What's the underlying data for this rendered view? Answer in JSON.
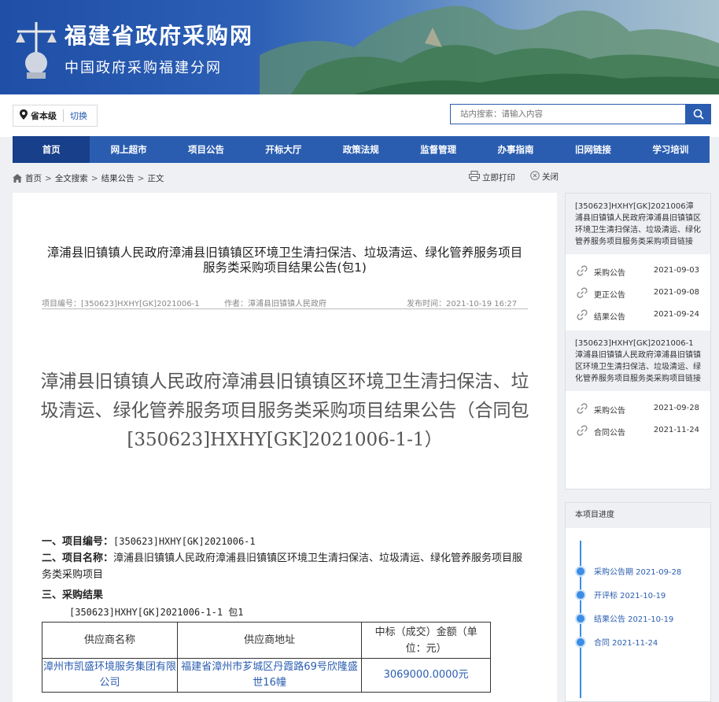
{
  "header": {
    "title": "福建省政府采购网",
    "subtitle": "中国政府采购福建分网"
  },
  "region": {
    "current": "省本级",
    "switch_label": "切换"
  },
  "search": {
    "placeholder": "站内搜索：请输入内容"
  },
  "nav": [
    "首页",
    "网上超市",
    "项目公告",
    "开标大厅",
    "政策法规",
    "监督管理",
    "办事指南",
    "旧网链接",
    "学习培训"
  ],
  "breadcrumb": [
    "首页",
    "全文搜索",
    "结果公告",
    "正文"
  ],
  "tools": {
    "print": "立即打印",
    "close": "关闭"
  },
  "article": {
    "title": "漳浦县旧镇镇人民政府漳浦县旧镇镇区环境卫生清扫保洁、垃圾清运、绿化管养服务项目服务类采购项目结果公告(包1)",
    "meta": {
      "project_no": "项目编号：[350623]HXHY[GK]2021006-1",
      "author": "作者：漳浦县旧镇镇人民政府",
      "published": "发布时间：2021-10-19 16:27"
    },
    "doc_heading": "漳浦县旧镇镇人民政府漳浦县旧镇镇区环境卫生清扫保洁、垃圾清运、绿化管养服务项目服务类采购项目结果公告（合同包[350623]HXHY[GK]2021006-1-1）",
    "sec1_label": "一、项目编号：",
    "sec1_value": "[350623]HXHY[GK]2021006-1",
    "sec2_label": "二、项目名称：",
    "sec2_value": "漳浦县旧镇镇人民政府漳浦县旧镇镇区环境卫生清扫保洁、垃圾清运、绿化管养服务项目服务类采购项目",
    "sec3_label": "三、采购结果",
    "package_line": "[350623]HXHY[GK]2021006-1-1 包1",
    "table": {
      "headers": [
        "供应商名称",
        "供应商地址",
        "中标（成交）金额（单位：元）"
      ],
      "rows": [
        [
          "漳州市凯盛环境服务集团有限公司",
          "福建省漳州市芗城区丹霞路69号欣隆盛世16幢",
          "3069000.0000元"
        ]
      ]
    }
  },
  "sidebar": {
    "groups": [
      {
        "title": "[350623]HXHY[GK]2021006漳浦县旧镇镇人民政府漳浦县旧镇镇区环境卫生清扫保洁、垃圾清运、绿化管养服务项目服务类采购项目链接",
        "links": [
          {
            "label": "采购公告",
            "date": "2021-09-03"
          },
          {
            "label": "更正公告",
            "date": "2021-09-08"
          },
          {
            "label": "结果公告",
            "date": "2021-09-24"
          }
        ]
      },
      {
        "title": "[350623]HXHY[GK]2021006-1漳浦县旧镇镇人民政府漳浦县旧镇镇区环境卫生清扫保洁、垃圾清运、绿化管养服务项目服务类采购项目链接",
        "links": [
          {
            "label": "采购公告",
            "date": "2021-09-28"
          },
          {
            "label": "合同公告",
            "date": "2021-11-24"
          }
        ]
      }
    ],
    "progress": {
      "title": "本项目进度",
      "steps": [
        "采购公告期 2021-09-28",
        "开评标 2021-10-19",
        "结果公告 2021-10-19",
        "合同 2021-11-24"
      ]
    }
  },
  "colors": {
    "primary": "#2a5db0",
    "nav_active": "#173f8a",
    "timeline": "#3a8ee6"
  }
}
